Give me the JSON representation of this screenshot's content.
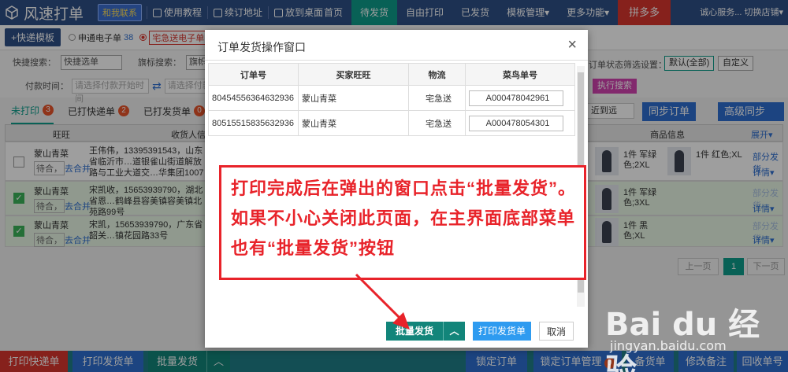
{
  "app": {
    "name": "风速打单"
  },
  "topbar": {
    "badge": "和我联系",
    "links": [
      "使用教程",
      "续订地址",
      "放到桌面"
    ],
    "nav": [
      "首页",
      "待发货",
      "自由打印",
      "已发货",
      "模板管理▾",
      "更多功能▾",
      "拼多多"
    ],
    "active_nav": "待发货",
    "right": "诚心服务...  切换店铺▾"
  },
  "template_row": {
    "button": "+快递模板",
    "radios": [
      {
        "label": "申通电子单",
        "count": "38"
      },
      {
        "label": "宅急送电子单",
        "count": ""
      }
    ]
  },
  "search": {
    "quick_label": "快捷搜索：",
    "quick_value": "快捷选单",
    "flag_label": "旗标搜索：",
    "flag_value": "旗帜",
    "pay_label": "付款时间：",
    "start_placeholder": "请选择付款开始时间",
    "end_placeholder": "请选择付款",
    "status_label": "订单状态筛选设置：",
    "default_btn": "默认(全部)",
    "custom_btn": "自定义",
    "exec_btn": "执行搜索"
  },
  "tabs": [
    {
      "label": "未打印",
      "count": "3"
    },
    {
      "label": "已打快递单",
      "count": "2"
    },
    {
      "label": "已打发货单",
      "count": "0"
    }
  ],
  "sort": "近到远",
  "sync_btn": "同步订单",
  "advanced_sync": "高级同步",
  "table_head": {
    "buyer": "旺旺",
    "receiver": "收货人信息",
    "goods": "商品信息",
    "expand": "展开▾"
  },
  "orders": [
    {
      "nick": "蒙山青菜",
      "pend": "待合，",
      "merge": "去合并",
      "addr": "王伟伟，13395391543，山东省临沂市…道银雀山街道解放路与工业大道交…华集团1007",
      "goods1": "1件 军绿色;2XL",
      "goods2": "1件 红色;XL",
      "side1": "部分发货",
      "side2": "详情▾"
    },
    {
      "nick": "蒙山青菜",
      "pend": "待合，",
      "merge": "去合并",
      "addr": "宋凯收，15653939790，湖北省恩…鹤峰县容美镇容美镇北苑路99号",
      "goods1": "1件 军绿色;3XL",
      "goods2": "",
      "side1": "部分发货",
      "side2": "详情▾"
    },
    {
      "nick": "蒙山青菜",
      "pend": "待合，",
      "merge": "去合并",
      "addr": "宋凯，15653939790，广东省韶关…镇花园路33号",
      "goods1": "1件 黑色;XL",
      "goods2": "",
      "side1": "部分发货",
      "side2": "详情▾"
    }
  ],
  "pager": {
    "prev": "上一页",
    "current": "1",
    "next": "下一页"
  },
  "bottombar": {
    "print_express": "打印快递单",
    "print_ship": "打印发货单",
    "batch_ship": "批量发货",
    "lock": "锁定订单",
    "lock_manage": "锁定订单管理",
    "lock_count": "0",
    "stock": "备货单",
    "edit_note": "修改备注",
    "recycle": "回收单号"
  },
  "modal": {
    "title": "订单发货操作窗口",
    "close": "×",
    "headers": [
      "订单号",
      "买家旺旺",
      "物流",
      "菜鸟单号"
    ],
    "rows": [
      {
        "order_no": "80454556364632936",
        "buyer": "蒙山青菜",
        "logistics": "宅急送",
        "tracking": "A000478042961"
      },
      {
        "order_no": "80515515835632936",
        "buyer": "蒙山青菜",
        "logistics": "宅急送",
        "tracking": "A000478054301"
      }
    ],
    "batch_btn": "批量发货",
    "print_btn": "打印发货单",
    "cancel_btn": "取消"
  },
  "annotation": "打印完成后在弹出的窗口点击“批量发货”。如果不小心关闭此页面，在主界面底部菜单也有“批量发货”按钮",
  "watermark": {
    "brand": "Bai du 经验",
    "url": "jingyan.baidu.com"
  }
}
